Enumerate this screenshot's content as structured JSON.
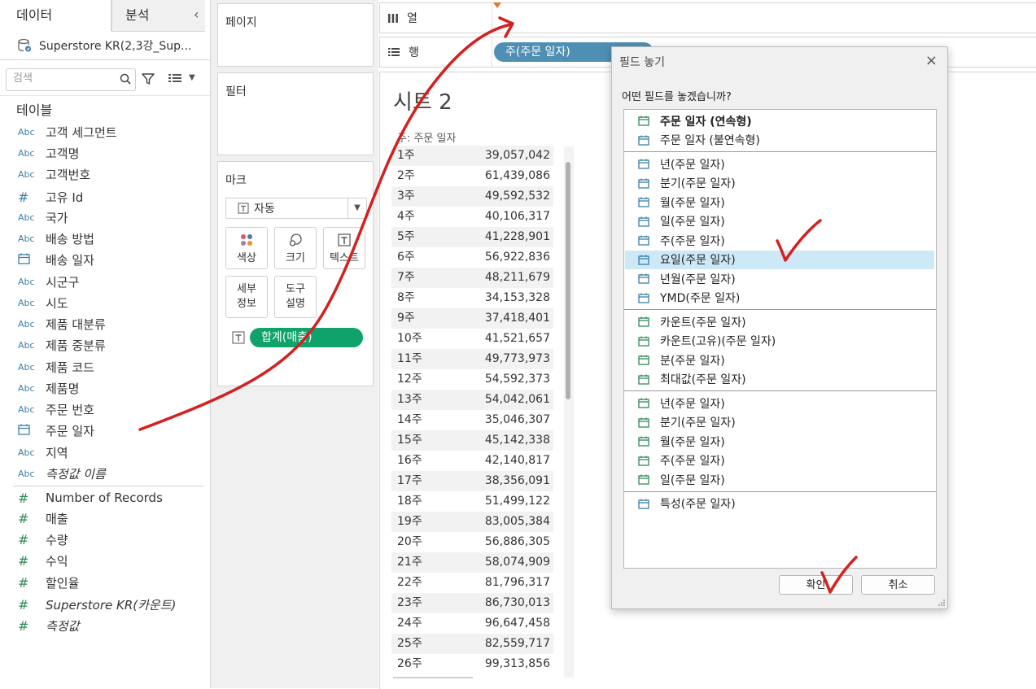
{
  "data_pane": {
    "tab_data": "데이터",
    "tab_analysis": "분석",
    "collapse_glyph": "‹",
    "datasource": "Superstore KR(2,3강_Sup...",
    "search_placeholder": "검색",
    "tables_title": "테이블",
    "fields": [
      {
        "type": "Abc",
        "label": "고객 세그먼트"
      },
      {
        "type": "Abc",
        "label": "고객명"
      },
      {
        "type": "Abc",
        "label": "고객번호"
      },
      {
        "type": "#",
        "label": "고유 Id"
      },
      {
        "type": "Abc",
        "label": "국가"
      },
      {
        "type": "Abc",
        "label": "배송 방법"
      },
      {
        "type": "date",
        "label": "배송 일자"
      },
      {
        "type": "Abc",
        "label": "시군구"
      },
      {
        "type": "Abc",
        "label": "시도"
      },
      {
        "type": "Abc",
        "label": "제품 대분류"
      },
      {
        "type": "Abc",
        "label": "제품 중분류"
      },
      {
        "type": "Abc",
        "label": "제품 코드"
      },
      {
        "type": "Abc",
        "label": "제품명"
      },
      {
        "type": "Abc",
        "label": "주문 번호"
      },
      {
        "type": "date",
        "label": "주문 일자"
      },
      {
        "type": "Abc",
        "label": "지역"
      },
      {
        "type": "Abc",
        "label": "측정값 이름",
        "italic": true
      }
    ],
    "measures": [
      {
        "label": "Number of Records"
      },
      {
        "label": "매출"
      },
      {
        "label": "수량"
      },
      {
        "label": "수익"
      },
      {
        "label": "할인율"
      },
      {
        "label": "Superstore KR(카운트)",
        "italic": true
      },
      {
        "label": "측정값",
        "italic": true
      }
    ]
  },
  "shelves": {
    "pages": "페이지",
    "filters": "필터",
    "marks": "마크",
    "mark_type": "자동",
    "mark_buttons": {
      "color": "색상",
      "size": "크기",
      "text": "텍스트",
      "detail": "세부\n정보",
      "tooltip": "도구\n설명"
    },
    "marks_pill": "합계(매출)",
    "columns": "열",
    "rows": "행",
    "rows_pill": "주(주문 일자)"
  },
  "sheet": {
    "title": "시트 2",
    "column_header": "주: 주문 일자",
    "rows": [
      {
        "label": "1주",
        "value": "39,057,042"
      },
      {
        "label": "2주",
        "value": "61,439,086"
      },
      {
        "label": "3주",
        "value": "49,592,532"
      },
      {
        "label": "4주",
        "value": "40,106,317"
      },
      {
        "label": "5주",
        "value": "41,228,901"
      },
      {
        "label": "6주",
        "value": "56,922,836"
      },
      {
        "label": "7주",
        "value": "48,211,679"
      },
      {
        "label": "8주",
        "value": "34,153,328"
      },
      {
        "label": "9주",
        "value": "37,418,401"
      },
      {
        "label": "10주",
        "value": "41,521,657"
      },
      {
        "label": "11주",
        "value": "49,773,973"
      },
      {
        "label": "12주",
        "value": "54,592,373"
      },
      {
        "label": "13주",
        "value": "54,042,061"
      },
      {
        "label": "14주",
        "value": "35,046,307"
      },
      {
        "label": "15주",
        "value": "45,142,338"
      },
      {
        "label": "16주",
        "value": "42,140,817"
      },
      {
        "label": "17주",
        "value": "38,356,091"
      },
      {
        "label": "18주",
        "value": "51,499,122"
      },
      {
        "label": "19주",
        "value": "83,005,384"
      },
      {
        "label": "20주",
        "value": "56,886,305"
      },
      {
        "label": "21주",
        "value": "58,074,909"
      },
      {
        "label": "22주",
        "value": "81,796,317"
      },
      {
        "label": "23주",
        "value": "86,730,013"
      },
      {
        "label": "24주",
        "value": "96,647,458"
      },
      {
        "label": "25주",
        "value": "82,559,717"
      },
      {
        "label": "26주",
        "value": "99,313,856"
      }
    ]
  },
  "dialog": {
    "title": "필드 놓기",
    "close": "×",
    "question": "어떤 필드를 놓겠습니까?",
    "groups": [
      [
        {
          "label": "주문 일자 (연속형)",
          "bold": true,
          "color": "green"
        },
        {
          "label": "주문 일자 (불연속형)",
          "color": "blue"
        }
      ],
      [
        {
          "label": "년(주문 일자)",
          "color": "blue"
        },
        {
          "label": "분기(주문 일자)",
          "color": "blue"
        },
        {
          "label": "월(주문 일자)",
          "color": "blue"
        },
        {
          "label": "일(주문 일자)",
          "color": "blue"
        },
        {
          "label": "주(주문 일자)",
          "color": "blue"
        },
        {
          "label": "요일(주문 일자)",
          "color": "blue",
          "selected": true
        },
        {
          "label": "년월(주문 일자)",
          "color": "blue"
        },
        {
          "label": "YMD(주문 일자)",
          "color": "blue"
        }
      ],
      [
        {
          "label": "카운트(주문 일자)",
          "color": "green"
        },
        {
          "label": "카운트(고유)(주문 일자)",
          "color": "green"
        },
        {
          "label": "분(주문 일자)",
          "color": "green"
        },
        {
          "label": "최대값(주문 일자)",
          "color": "green"
        }
      ],
      [
        {
          "label": "년(주문 일자)",
          "color": "green"
        },
        {
          "label": "분기(주문 일자)",
          "color": "green"
        },
        {
          "label": "월(주문 일자)",
          "color": "green"
        },
        {
          "label": "주(주문 일자)",
          "color": "green"
        },
        {
          "label": "일(주문 일자)",
          "color": "green"
        }
      ],
      [
        {
          "label": "특성(주문 일자)",
          "color": "blue"
        }
      ]
    ],
    "ok": "확인",
    "cancel": "취소"
  },
  "colors": {
    "dimension_blue": "#3b7fa6",
    "measure_green": "#2e8b57",
    "pill_green": "#0fa36b",
    "pill_blue": "#4f8fb3",
    "selected_row": "#cde8f7",
    "annotation_red": "#d42020"
  }
}
